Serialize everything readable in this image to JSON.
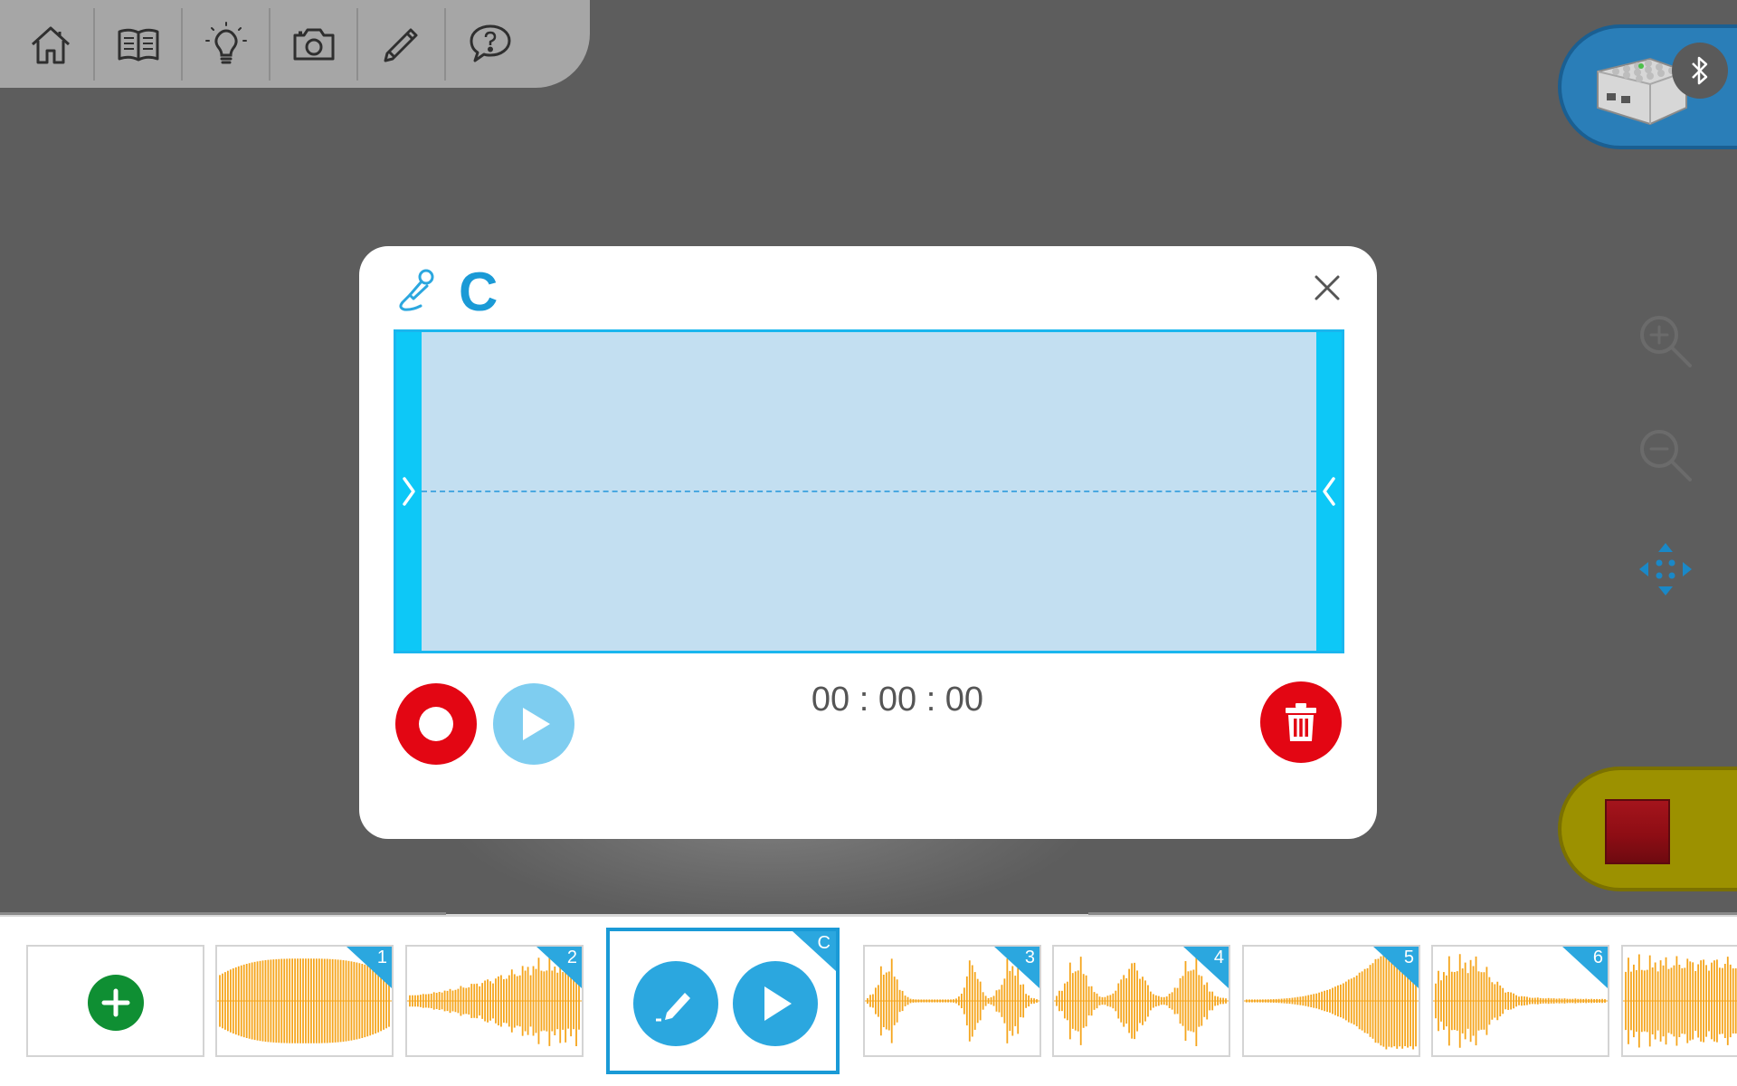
{
  "toolbar": {
    "items": [
      {
        "icon": "home-icon"
      },
      {
        "icon": "book-icon"
      },
      {
        "icon": "lightbulb-icon"
      },
      {
        "icon": "camera-icon"
      },
      {
        "icon": "pencil-icon"
      },
      {
        "icon": "help-icon"
      }
    ]
  },
  "hub": {
    "icon": "smarthub-icon",
    "status_icon": "bluetooth-icon"
  },
  "side_tools": [
    "zoom-in-icon",
    "zoom-out-icon",
    "move-arrows-icon"
  ],
  "stop": {
    "icon": "stop-icon",
    "color": "#9c9100"
  },
  "dialog": {
    "title": "C",
    "icon": "microphone-edit-icon",
    "time": "00 : 00 : 00",
    "record_color": "#e30613",
    "play_color": "#7ecdf0",
    "delete_color": "#e30613",
    "waveform_bg": "#c3dff1",
    "trim_color": "#0dc8f7"
  },
  "sound_strip": {
    "add_icon": "plus-icon",
    "selected": {
      "label": "C",
      "edit_icon": "pencil-icon",
      "play_icon": "play-icon"
    },
    "sounds": [
      {
        "label": "1"
      },
      {
        "label": "2"
      },
      {
        "label": "3"
      },
      {
        "label": "4"
      },
      {
        "label": "5"
      },
      {
        "label": "6"
      }
    ],
    "wave_color": "#f5a51c",
    "corner_color": "#2ba7df"
  }
}
